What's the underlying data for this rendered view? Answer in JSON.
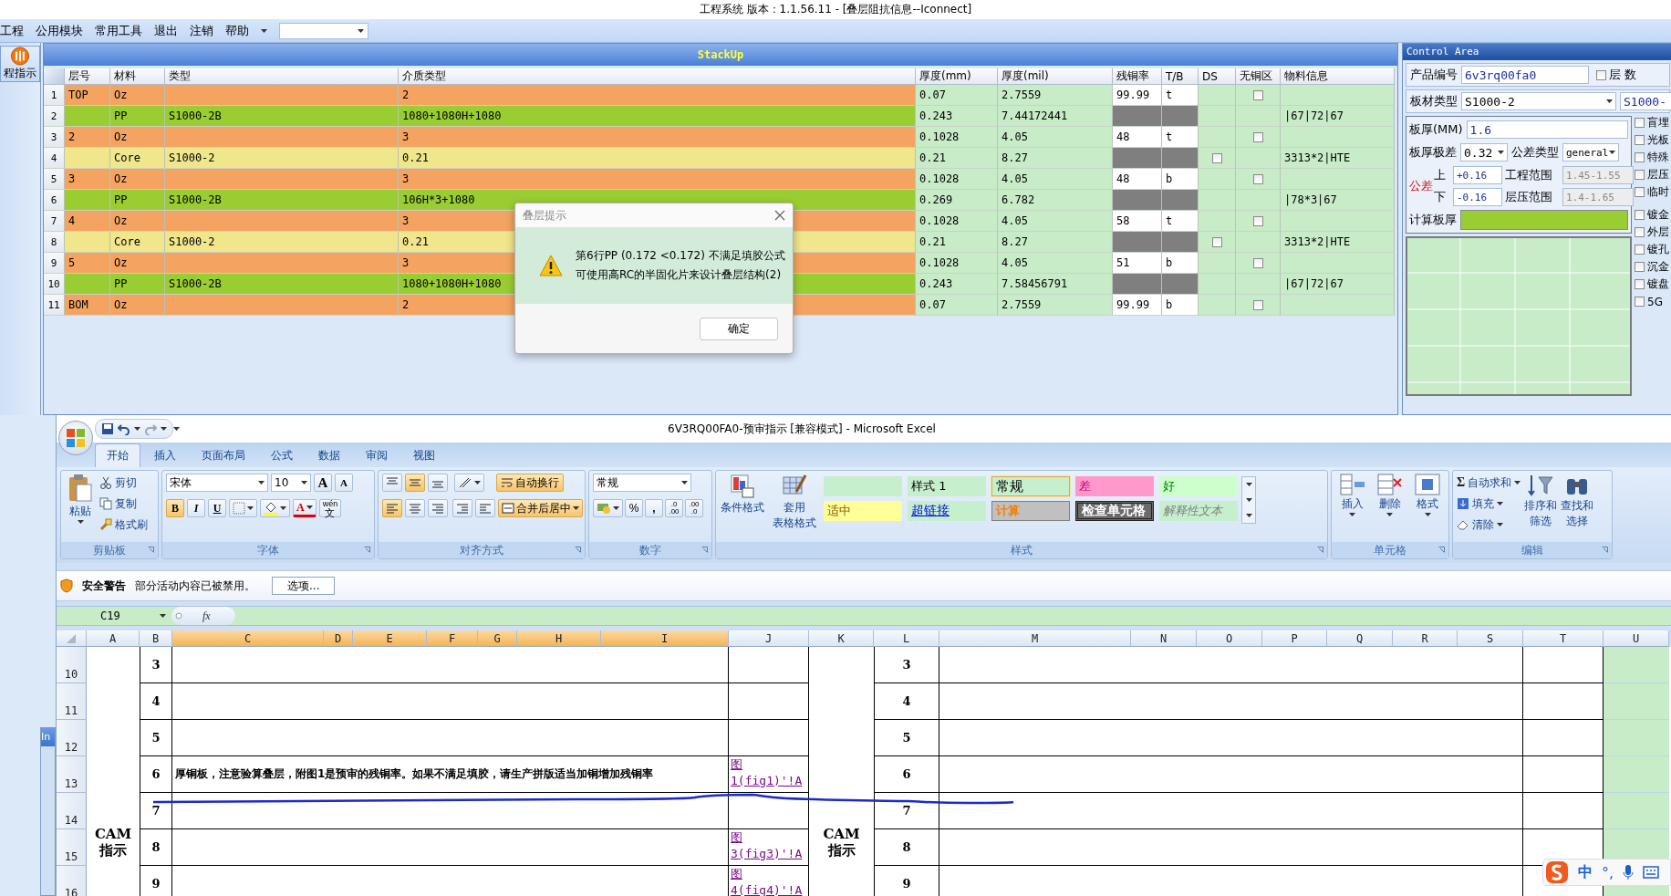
{
  "window": {
    "title": "工程系统  版本：1.1.56.11 - [叠层阻抗信息--Iconnect]"
  },
  "menu": [
    "工程",
    "公用模块",
    "常用工具",
    "退出",
    "注销",
    "帮助"
  ],
  "sidebar": {
    "items": [
      {
        "label": "程指示",
        "selected": true
      }
    ]
  },
  "inactive_window": {
    "title": "In"
  },
  "stackup": {
    "title": "StackUp",
    "columns": [
      "层号",
      "材料",
      "类型",
      "介质类型",
      "厚度(mm)",
      "厚度(mil)",
      "残铜率",
      "T/B",
      "DS",
      "无铜区",
      "物料信息"
    ],
    "rows": [
      {
        "num": "1",
        "kind": "copper",
        "layer": "TOP",
        "material": "Oz",
        "dielectric": "2",
        "thick_mm": "0.07",
        "thick_mil": "2.7559",
        "residual": "99.99",
        "side": "t",
        "no_copper": {
          "checked": false
        }
      },
      {
        "num": "2",
        "kind": "pp",
        "material": "PP",
        "type": "S1000-2B",
        "dielectric": "1080+1080H+1080",
        "thick_mm": "0.243",
        "thick_mil": "7.44172441",
        "info": "|67|72|67"
      },
      {
        "num": "3",
        "kind": "copper",
        "layer": "2",
        "material": "Oz",
        "dielectric": "3",
        "thick_mm": "0.1028",
        "thick_mil": "4.05",
        "residual": "48",
        "side": "t",
        "no_copper": {
          "checked": false
        }
      },
      {
        "num": "4",
        "kind": "core",
        "material": "Core",
        "type": "S1000-2",
        "dielectric": "0.21",
        "thick_mm": "0.21",
        "thick_mil": "8.27",
        "ds": {
          "checked": false
        },
        "info": "3313*2|HTE"
      },
      {
        "num": "5",
        "kind": "copper",
        "layer": "3",
        "material": "Oz",
        "dielectric": "3",
        "thick_mm": "0.1028",
        "thick_mil": "4.05",
        "residual": "48",
        "side": "b",
        "no_copper": {
          "checked": false
        }
      },
      {
        "num": "6",
        "kind": "pp",
        "material": "PP",
        "type": "S1000-2B",
        "dielectric": "106H*3+1080",
        "thick_mm": "0.269",
        "thick_mil": "6.782",
        "info": "|78*3|67"
      },
      {
        "num": "7",
        "kind": "copper",
        "layer": "4",
        "material": "Oz",
        "dielectric": "3",
        "thick_mm": "0.1028",
        "thick_mil": "4.05",
        "residual": "58",
        "side": "t",
        "no_copper": {
          "checked": false
        }
      },
      {
        "num": "8",
        "kind": "core",
        "material": "Core",
        "type": "S1000-2",
        "dielectric": "0.21",
        "thick_mm": "0.21",
        "thick_mil": "8.27",
        "ds": {
          "checked": false
        },
        "info": "3313*2|HTE"
      },
      {
        "num": "9",
        "kind": "copper",
        "layer": "5",
        "material": "Oz",
        "dielectric": "3",
        "thick_mm": "0.1028",
        "thick_mil": "4.05",
        "residual": "51",
        "side": "b",
        "no_copper": {
          "checked": false
        }
      },
      {
        "num": "10",
        "kind": "pp",
        "material": "PP",
        "type": "S1000-2B",
        "dielectric": "1080+1080H+1080",
        "thick_mm": "0.243",
        "thick_mil": "7.58456791",
        "info": "|67|72|67"
      },
      {
        "num": "11",
        "kind": "copper",
        "layer": "BOM",
        "material": "Oz",
        "dielectric": "2",
        "thick_mm": "0.07",
        "thick_mil": "2.7559",
        "residual": "99.99",
        "side": "b",
        "no_copper": {
          "checked": false
        }
      }
    ]
  },
  "dialog": {
    "title": "叠层提示",
    "lines": [
      "第6行PP (0.172 <0.172) 不满足填胶公式",
      "可使用高RC的半固化片来设计叠层结构(2)"
    ],
    "button": "确定"
  },
  "control_area": {
    "title": "Control Area",
    "product_no": {
      "label": "产品编号",
      "value": "6v3rq00fa0"
    },
    "layer_count": {
      "label": "层 数",
      "checked": false
    },
    "board_type": {
      "label": "板材类型",
      "value": "S1000-2",
      "second": "S1000-"
    },
    "thickness": {
      "label": "板厚(MM)",
      "value": "1.6"
    },
    "range": {
      "label": "板厚极差",
      "value": "0.32"
    },
    "tol_type": {
      "label": "公差类型",
      "value": "general"
    },
    "tolerance": {
      "label": "公差",
      "upper_label": "上",
      "upper": "+0.16",
      "lower_label": "下",
      "lower": "-0.16"
    },
    "eng_range": {
      "label": "工程范围",
      "value": "1.45-1.55"
    },
    "press_range": {
      "label": "层压范围",
      "value": "1.4-1.65"
    },
    "calc": {
      "label": "计算板厚"
    },
    "options": [
      {
        "label": "盲埋",
        "checked": false
      },
      {
        "label": "光板",
        "checked": false
      },
      {
        "label": "特殊",
        "checked": false
      },
      {
        "label": "层压",
        "checked": false
      },
      {
        "label": "临时",
        "checked": false
      }
    ],
    "options2": [
      {
        "label": "镀金",
        "checked": false
      },
      {
        "label": "外层",
        "checked": false
      },
      {
        "label": "镀孔",
        "checked": false
      },
      {
        "label": "沉金",
        "checked": false
      },
      {
        "label": "镀盘",
        "checked": false
      },
      {
        "label": "5G",
        "checked": false
      }
    ]
  },
  "excel": {
    "title": "6V3RQ00FA0-预审指示  [兼容模式] - Microsoft Excel",
    "tabs": [
      {
        "label": "开始",
        "selected": true
      },
      {
        "label": "插入",
        "selected": false
      },
      {
        "label": "页面布局",
        "selected": false
      },
      {
        "label": "公式",
        "selected": false
      },
      {
        "label": "数据",
        "selected": false
      },
      {
        "label": "审阅",
        "selected": false
      },
      {
        "label": "视图",
        "selected": false
      }
    ],
    "clipboard": {
      "label": "剪贴板",
      "paste": "粘贴",
      "items": [
        "剪切",
        "复制",
        "格式刷"
      ]
    },
    "font": {
      "label": "字体",
      "name": "宋体",
      "size": "10",
      "grow": "A",
      "shrink": "A",
      "bold": "B",
      "italic": "I",
      "underline": "U",
      "color_letter": "A",
      "phonetic": [
        "wén",
        "文"
      ]
    },
    "alignment": {
      "label": "对齐方式",
      "wrap": "自动换行",
      "merge": "合并后居中"
    },
    "number": {
      "label": "数字",
      "format": "常规",
      "percent": "%",
      "comma": ",",
      "increase": [
        ".0",
        ".00"
      ],
      "decrease": [
        ".00",
        ".0"
      ]
    },
    "styles": {
      "label": "样式",
      "conditional": "条件格式",
      "table": [
        "套用",
        "表格格式"
      ],
      "cells": [
        {
          "kind": "blank"
        },
        {
          "kind": "plain",
          "label": "样式 1"
        },
        {
          "kind": "normal",
          "label": "常规"
        },
        {
          "kind": "bad",
          "label": "差"
        },
        {
          "kind": "good",
          "label": "好"
        },
        {
          "kind": "neutral",
          "label": "适中"
        },
        {
          "kind": "link",
          "label": "超链接"
        },
        {
          "kind": "calc",
          "label": "计算"
        },
        {
          "kind": "check",
          "label": "检查单元格"
        },
        {
          "kind": "note",
          "label": "解释性文本"
        }
      ]
    },
    "cells_group": {
      "label": "单元格",
      "items": [
        "插入",
        "删除",
        "格式"
      ]
    },
    "editing": {
      "label": "编辑",
      "sum_symbol": "Σ",
      "items": [
        "自动求和",
        "填充",
        "清除"
      ],
      "big": [
        [
          "排序和",
          "筛选"
        ],
        [
          "查找和",
          "选择"
        ]
      ]
    },
    "security": {
      "title": "安全警告",
      "message": "部分活动内容已被禁用。",
      "button": "选项..."
    },
    "formula_bar": {
      "name_box": "C19",
      "fx": "fx"
    },
    "sheet": {
      "columns": [
        {
          "label": "A",
          "selected": false
        },
        {
          "label": "B",
          "selected": false
        },
        {
          "label": "C",
          "selected": true
        },
        {
          "label": "D",
          "selected": true
        },
        {
          "label": "E",
          "selected": true
        },
        {
          "label": "F",
          "selected": true
        },
        {
          "label": "G",
          "selected": true
        },
        {
          "label": "H",
          "selected": true
        },
        {
          "label": "I",
          "selected": true
        },
        {
          "label": "J",
          "selected": false
        },
        {
          "label": "K",
          "selected": false
        },
        {
          "label": "L",
          "selected": false
        },
        {
          "label": "M",
          "selected": false
        },
        {
          "label": "N",
          "selected": false
        },
        {
          "label": "O",
          "selected": false
        },
        {
          "label": "P",
          "selected": false
        },
        {
          "label": "Q",
          "selected": false
        },
        {
          "label": "R",
          "selected": false
        },
        {
          "label": "S",
          "selected": false
        },
        {
          "label": "T",
          "selected": false
        },
        {
          "label": "U",
          "selected": false
        }
      ],
      "side_labels": [
        "CAM 指示",
        "CAM 指示"
      ],
      "rows": [
        {
          "header": "10",
          "b": "3",
          "l": "3"
        },
        {
          "header": "11",
          "b": "4",
          "l": "4"
        },
        {
          "header": "12",
          "b": "5",
          "l": "5"
        },
        {
          "header": "13",
          "b": "6",
          "c": "厚铜板，注意验算叠层，附图1是预审的残铜率。如果不满足填胶，请生产拼版适当加铜增加残铜率",
          "j": "图 1(fig1)'!A",
          "l": "6"
        },
        {
          "header": "14",
          "b": "7",
          "l": "7"
        },
        {
          "header": "15",
          "b": "8",
          "j": "图 3(fig3)'!A",
          "l": "8"
        },
        {
          "header": "16",
          "b": "9",
          "j": "图 4(fig4)'!A",
          "l": "9"
        }
      ]
    }
  },
  "ime_bar": {
    "items": [
      "中",
      "°,"
    ]
  }
}
